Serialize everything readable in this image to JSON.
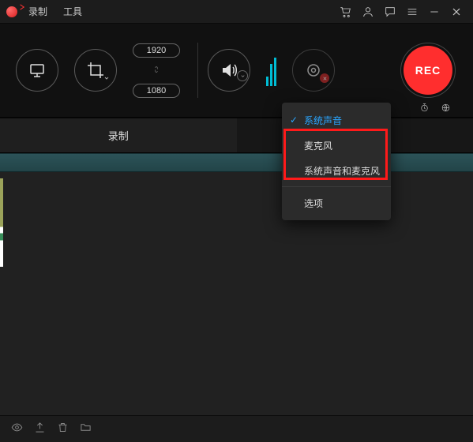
{
  "titlebar": {
    "menu_record": "录制",
    "menu_tools": "工具"
  },
  "toolbar": {
    "res_top": "1920",
    "res_bottom": "1080",
    "rec_label": "REC"
  },
  "tabs": {
    "record": "录制"
  },
  "dropdown": {
    "system_sound": "系统声音",
    "microphone": "麦克风",
    "both": "系统声音和麦克风",
    "options": "选项"
  }
}
